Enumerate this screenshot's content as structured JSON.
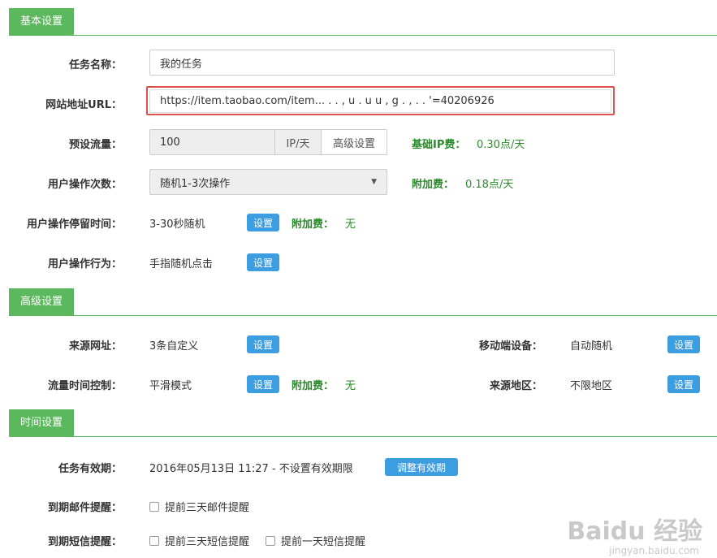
{
  "basic": {
    "section_title": "基本设置",
    "task_name": {
      "label": "任务名称：",
      "value": "我的任务"
    },
    "url": {
      "label": "网站地址URL：",
      "value": "https://item.taobao.com/item...  .  .  ,  u .   u  u  , g  .  ,  .  .  '=40206926"
    },
    "traffic": {
      "label": "预设流量：",
      "value": "100",
      "unit": "IP/天",
      "advanced_btn": "高级设置",
      "fee_label": "基础IP费：",
      "fee_value": "0.30点/天"
    },
    "ops_count": {
      "label": "用户操作次数：",
      "selected": "随机1-3次操作",
      "fee_label": "附加费：",
      "fee_value": "0.18点/天"
    },
    "stay_time": {
      "label": "用户操作停留时间：",
      "value": "3-30秒随机",
      "btn": "设置",
      "fee_label": "附加费：",
      "fee_value": "无"
    },
    "behavior": {
      "label": "用户操作行为：",
      "value": "手指随机点击",
      "btn": "设置"
    }
  },
  "advanced": {
    "section_title": "高级设置",
    "source_url": {
      "label": "来源网址：",
      "value": "3条自定义",
      "btn": "设置"
    },
    "mobile": {
      "label": "移动端设备：",
      "value": "自动随机",
      "btn": "设置"
    },
    "flow_time": {
      "label": "流量时间控制：",
      "value": "平滑模式",
      "btn": "设置",
      "fee_label": "附加费：",
      "fee_value": "无"
    },
    "region": {
      "label": "来源地区：",
      "value": "不限地区",
      "btn": "设置"
    }
  },
  "time": {
    "section_title": "时间设置",
    "validity": {
      "label": "任务有效期：",
      "value": "2016年05月13日 11:27 - 不设置有效期限",
      "btn": "调整有效期"
    },
    "email": {
      "label": "到期邮件提醒：",
      "opt1": "提前三天邮件提醒"
    },
    "sms": {
      "label": "到期短信提醒：",
      "opt1": "提前三天短信提醒",
      "opt2": "提前一天短信提醒"
    }
  },
  "watermark": {
    "logo": "Baidu 经验",
    "url": "jingyan.baidu.com"
  },
  "colors": {
    "accent_green": "#5cb85c",
    "fee_green": "#2a8a2a",
    "button_blue": "#3c9de0",
    "highlight_red": "#d9534f"
  }
}
